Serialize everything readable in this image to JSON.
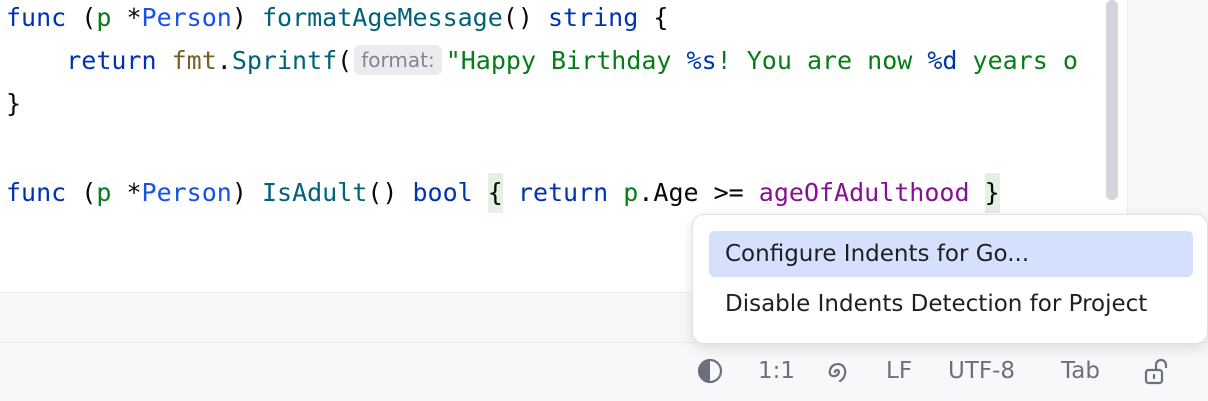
{
  "editor": {
    "line1": {
      "kw_func": "func",
      "open_paren": "(",
      "receiver": "p",
      "star": "*",
      "type": "Person",
      "close_paren": ")",
      "method": "formatAgeMessage",
      "parens": "()",
      "ret_type": "string",
      "brace": "{"
    },
    "line2": {
      "kw_return": "return",
      "pkg": "fmt",
      "dot": ".",
      "func": "Sprintf",
      "open_paren": "(",
      "hint": "format:",
      "str_part1": "\"Happy Birthday ",
      "fmt_s": "%s",
      "str_part2": "! You are now ",
      "fmt_d": "%d",
      "str_part3": " years o"
    },
    "line3": {
      "brace": "}"
    },
    "line5": {
      "kw_func": "func",
      "open_paren": "(",
      "receiver": "p",
      "star": "*",
      "type": "Person",
      "close_paren": ")",
      "method": "IsAdult",
      "parens": "()",
      "ret_type": "bool",
      "open_brace": "{",
      "kw_return": "return",
      "receiver2": "p",
      "dot": ".",
      "field": "Age",
      "op": ">=",
      "const": "ageOfAdulthood",
      "close_brace": "}"
    }
  },
  "popup": {
    "items": [
      {
        "label": "Configure Indents for Go...",
        "selected": true
      },
      {
        "label": "Disable Indents Detection for Project",
        "selected": false
      }
    ]
  },
  "status_bar": {
    "theme_icon": "half-circle-icon",
    "position": "1:1",
    "ai_icon": "spiral-icon",
    "line_separator": "LF",
    "encoding": "UTF-8",
    "indent": "Tab",
    "lock_icon": "unlocked-padlock-icon"
  },
  "colors": {
    "keyword": "#0033b3",
    "type": "#1750eb",
    "string": "#067d17",
    "constant": "#871094",
    "selection": "#d5e0fc"
  }
}
